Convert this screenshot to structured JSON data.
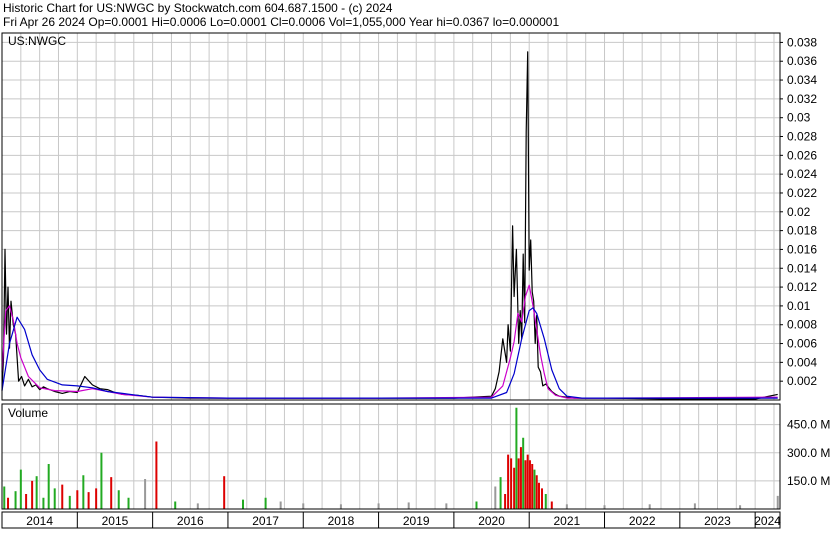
{
  "header": {
    "line1": "Historic Chart for US:NWGC by Stockwatch.com 604.687.1500 - (c) 2024",
    "line2": "Fri Apr 26 2024   Op=0.0001   Hi=0.0006   Lo=0.0001   Cl=0.0006   Vol=1,055,000   Year hi=0.0367   lo=0.000001"
  },
  "colors": {
    "price": "#000000",
    "ma_short": "#cc00cc",
    "ma_long": "#0000cc",
    "vol_up": "#22aa22",
    "vol_down": "#dd0000",
    "vol_neutral": "#999999",
    "grid": "#c8c8c8",
    "frame": "#000000"
  },
  "chart_data": [
    {
      "type": "line",
      "label": "US:NWGC",
      "grid": true,
      "x_ticks": [
        "2014",
        "2015",
        "2016",
        "2017",
        "2018",
        "2019",
        "2020",
        "2021",
        "2022",
        "2023",
        "2024"
      ],
      "y_ticks": [
        "0.002",
        "0.004",
        "0.006",
        "0.008",
        "0.01",
        "0.012",
        "0.014",
        "0.016",
        "0.018",
        "0.02",
        "0.022",
        "0.024",
        "0.026",
        "0.028",
        "0.03",
        "0.032",
        "0.034",
        "0.036",
        "0.038"
      ],
      "ylim": [
        0,
        0.039
      ],
      "xlim": [
        2014.0,
        2024.33
      ],
      "series": [
        {
          "style": "price",
          "x": [
            2014.0,
            2014.02,
            2014.04,
            2014.06,
            2014.08,
            2014.1,
            2014.12,
            2014.15,
            2014.18,
            2014.22,
            2014.26,
            2014.3,
            2014.35,
            2014.4,
            2014.45,
            2014.5,
            2014.55,
            2014.6,
            2014.7,
            2014.8,
            2014.9,
            2015.0,
            2015.1,
            2015.2,
            2015.3,
            2015.4,
            2015.5,
            2015.6,
            2015.8,
            2016.0,
            2016.5,
            2017.0,
            2018.0,
            2019.0,
            2020.0,
            2020.5,
            2020.55,
            2020.6,
            2020.65,
            2020.7,
            2020.72,
            2020.75,
            2020.78,
            2020.8,
            2020.83,
            2020.86,
            2020.88,
            2020.9,
            2020.92,
            2020.94,
            2020.96,
            2020.98,
            2021.0,
            2021.02,
            2021.04,
            2021.06,
            2021.08,
            2021.1,
            2021.12,
            2021.15,
            2021.18,
            2021.22,
            2021.26,
            2021.3,
            2021.35,
            2021.4,
            2021.5,
            2021.6,
            2021.8,
            2022.0,
            2023.0,
            2024.0,
            2024.3
          ],
          "y": [
            0.001,
            0.0045,
            0.016,
            0.007,
            0.012,
            0.0055,
            0.0105,
            0.008,
            0.007,
            0.002,
            0.0025,
            0.0015,
            0.0022,
            0.0014,
            0.0016,
            0.0011,
            0.0014,
            0.0012,
            0.0009,
            0.0007,
            0.0009,
            0.0008,
            0.0025,
            0.0016,
            0.0012,
            0.0011,
            0.0008,
            0.0006,
            0.0005,
            0.0003,
            0.0002,
            0.0002,
            0.0002,
            0.0002,
            0.0002,
            0.0004,
            0.0012,
            0.003,
            0.0065,
            0.004,
            0.008,
            0.0052,
            0.0185,
            0.011,
            0.016,
            0.006,
            0.0095,
            0.0065,
            0.0155,
            0.0082,
            0.0285,
            0.037,
            0.0138,
            0.017,
            0.0115,
            0.0105,
            0.006,
            0.009,
            0.0035,
            0.003,
            0.0015,
            0.0017,
            0.0013,
            0.0009,
            0.0006,
            0.0004,
            0.0003,
            0.0002,
            0.0002,
            0.0002,
            0.0001,
            0.0001,
            0.0006
          ]
        },
        {
          "style": "ma_short",
          "x": [
            2014.0,
            2014.05,
            2014.1,
            2014.15,
            2014.2,
            2014.25,
            2014.35,
            2014.5,
            2014.7,
            2015.0,
            2015.2,
            2015.4,
            2015.6,
            2016.0,
            2017.0,
            2019.0,
            2020.5,
            2020.65,
            2020.75,
            2020.8,
            2020.85,
            2020.9,
            2020.95,
            2021.0,
            2021.05,
            2021.1,
            2021.15,
            2021.2,
            2021.25,
            2021.35,
            2021.5,
            2022.0,
            2024.3
          ],
          "y": [
            0.003,
            0.0095,
            0.01,
            0.0085,
            0.006,
            0.0045,
            0.0025,
            0.0013,
            0.001,
            0.0009,
            0.0012,
            0.0009,
            0.0006,
            0.0003,
            0.0002,
            0.0002,
            0.0003,
            0.0015,
            0.0045,
            0.0062,
            0.0092,
            0.0083,
            0.011,
            0.0122,
            0.01,
            0.0075,
            0.0048,
            0.0028,
            0.0012,
            0.0005,
            0.0002,
            0.0002,
            0.0003
          ]
        },
        {
          "style": "ma_long",
          "x": [
            2014.0,
            2014.1,
            2014.2,
            2014.3,
            2014.4,
            2014.5,
            2014.6,
            2014.8,
            2015.0,
            2015.2,
            2015.4,
            2015.6,
            2015.8,
            2016.0,
            2017.0,
            2019.0,
            2020.5,
            2020.7,
            2020.8,
            2020.9,
            2021.0,
            2021.05,
            2021.1,
            2021.2,
            2021.3,
            2021.4,
            2021.5,
            2021.7,
            2022.0,
            2024.3
          ],
          "y": [
            0.001,
            0.006,
            0.0088,
            0.0075,
            0.0048,
            0.0032,
            0.0022,
            0.0016,
            0.0015,
            0.0013,
            0.0009,
            0.0007,
            0.0005,
            0.0003,
            0.0002,
            0.0002,
            0.0002,
            0.0008,
            0.0028,
            0.0065,
            0.0095,
            0.0098,
            0.0092,
            0.0065,
            0.0032,
            0.0012,
            0.0004,
            0.0002,
            0.0002,
            0.0002
          ]
        }
      ]
    },
    {
      "type": "bar",
      "label": "Volume",
      "y_ticks": [
        "150.0 M",
        "300.0 M",
        "450.0 M"
      ],
      "ylim": [
        0,
        560
      ],
      "unit": "M",
      "bars": [
        {
          "x": 2014.03,
          "v": 120,
          "c": "up"
        },
        {
          "x": 2014.08,
          "v": 60,
          "c": "down"
        },
        {
          "x": 2014.18,
          "v": 95,
          "c": "up"
        },
        {
          "x": 2014.25,
          "v": 210,
          "c": "up"
        },
        {
          "x": 2014.32,
          "v": 80,
          "c": "down"
        },
        {
          "x": 2014.4,
          "v": 150,
          "c": "down"
        },
        {
          "x": 2014.46,
          "v": 175,
          "c": "up"
        },
        {
          "x": 2014.55,
          "v": 60,
          "c": "up"
        },
        {
          "x": 2014.62,
          "v": 240,
          "c": "up"
        },
        {
          "x": 2014.7,
          "v": 110,
          "c": "up"
        },
        {
          "x": 2014.8,
          "v": 130,
          "c": "down"
        },
        {
          "x": 2014.9,
          "v": 70,
          "c": "up"
        },
        {
          "x": 2015.0,
          "v": 100,
          "c": "down"
        },
        {
          "x": 2015.08,
          "v": 180,
          "c": "up"
        },
        {
          "x": 2015.15,
          "v": 90,
          "c": "down"
        },
        {
          "x": 2015.25,
          "v": 110,
          "c": "down"
        },
        {
          "x": 2015.32,
          "v": 300,
          "c": "up"
        },
        {
          "x": 2015.45,
          "v": 170,
          "c": "down"
        },
        {
          "x": 2015.55,
          "v": 100,
          "c": "up"
        },
        {
          "x": 2015.68,
          "v": 60,
          "c": "up"
        },
        {
          "x": 2015.9,
          "v": 160,
          "c": "neutral"
        },
        {
          "x": 2016.05,
          "v": 360,
          "c": "down"
        },
        {
          "x": 2016.3,
          "v": 40,
          "c": "up"
        },
        {
          "x": 2016.6,
          "v": 30,
          "c": "neutral"
        },
        {
          "x": 2016.95,
          "v": 175,
          "c": "down"
        },
        {
          "x": 2017.2,
          "v": 50,
          "c": "up"
        },
        {
          "x": 2017.5,
          "v": 60,
          "c": "up"
        },
        {
          "x": 2017.7,
          "v": 40,
          "c": "neutral"
        },
        {
          "x": 2018.0,
          "v": 30,
          "c": "neutral"
        },
        {
          "x": 2018.5,
          "v": 25,
          "c": "neutral"
        },
        {
          "x": 2019.0,
          "v": 30,
          "c": "neutral"
        },
        {
          "x": 2019.4,
          "v": 35,
          "c": "neutral"
        },
        {
          "x": 2019.9,
          "v": 30,
          "c": "neutral"
        },
        {
          "x": 2020.3,
          "v": 40,
          "c": "up"
        },
        {
          "x": 2020.55,
          "v": 120,
          "c": "neutral"
        },
        {
          "x": 2020.62,
          "v": 170,
          "c": "up"
        },
        {
          "x": 2020.68,
          "v": 80,
          "c": "down"
        },
        {
          "x": 2020.72,
          "v": 290,
          "c": "down"
        },
        {
          "x": 2020.76,
          "v": 270,
          "c": "down"
        },
        {
          "x": 2020.8,
          "v": 220,
          "c": "down"
        },
        {
          "x": 2020.83,
          "v": 540,
          "c": "up"
        },
        {
          "x": 2020.86,
          "v": 270,
          "c": "down"
        },
        {
          "x": 2020.89,
          "v": 330,
          "c": "down"
        },
        {
          "x": 2020.92,
          "v": 380,
          "c": "up"
        },
        {
          "x": 2020.95,
          "v": 260,
          "c": "down"
        },
        {
          "x": 2020.98,
          "v": 290,
          "c": "down"
        },
        {
          "x": 2021.01,
          "v": 260,
          "c": "down"
        },
        {
          "x": 2021.04,
          "v": 240,
          "c": "down"
        },
        {
          "x": 2021.07,
          "v": 210,
          "c": "up"
        },
        {
          "x": 2021.1,
          "v": 180,
          "c": "down"
        },
        {
          "x": 2021.13,
          "v": 140,
          "c": "down"
        },
        {
          "x": 2021.17,
          "v": 110,
          "c": "down"
        },
        {
          "x": 2021.22,
          "v": 80,
          "c": "up"
        },
        {
          "x": 2021.3,
          "v": 40,
          "c": "down"
        },
        {
          "x": 2021.5,
          "v": 25,
          "c": "neutral"
        },
        {
          "x": 2022.0,
          "v": 20,
          "c": "neutral"
        },
        {
          "x": 2022.6,
          "v": 25,
          "c": "neutral"
        },
        {
          "x": 2023.2,
          "v": 30,
          "c": "neutral"
        },
        {
          "x": 2023.8,
          "v": 20,
          "c": "neutral"
        },
        {
          "x": 2024.3,
          "v": 70,
          "c": "neutral"
        }
      ]
    }
  ]
}
